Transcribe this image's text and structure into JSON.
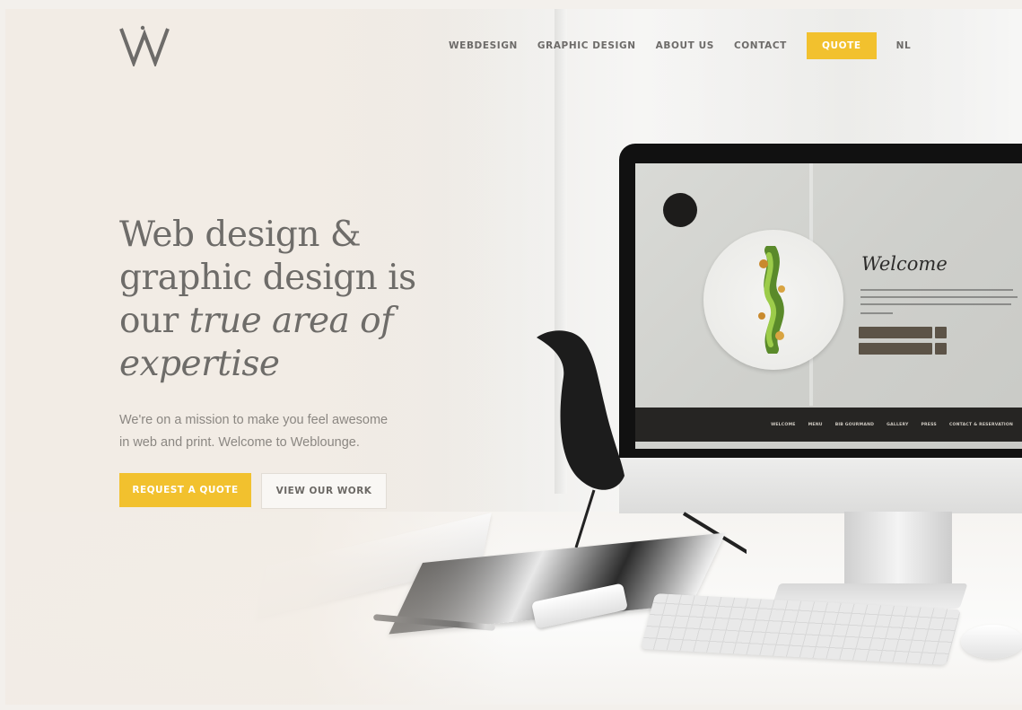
{
  "brand": {
    "logo_icon": "weblounge-w-logo",
    "accent_color": "#f2c12e"
  },
  "nav": {
    "items": [
      "WEBDESIGN",
      "GRAPHIC DESIGN",
      "ABOUT US",
      "CONTACT"
    ],
    "quote_label": "QUOTE",
    "language_label": "NL"
  },
  "hero": {
    "headline_line1": "Web design &",
    "headline_line2": "graphic design is",
    "headline_line3_plain": "our ",
    "headline_line3_italic": "true area of",
    "headline_line4_italic": "expertise",
    "sub_line1": "We're on a mission to make you feel awesome",
    "sub_line2": "in web and print. Welcome to Weblounge.",
    "primary_button": "REQUEST A QUOTE",
    "secondary_button": "VIEW OUR WORK"
  },
  "monitor_screen": {
    "welcome_title": "Welcome",
    "nav_items": [
      "WELCOME",
      "MENU",
      "BIB GOURMAND",
      "GALLERY",
      "PRESS",
      "CONTACT & RESERVATION"
    ]
  }
}
